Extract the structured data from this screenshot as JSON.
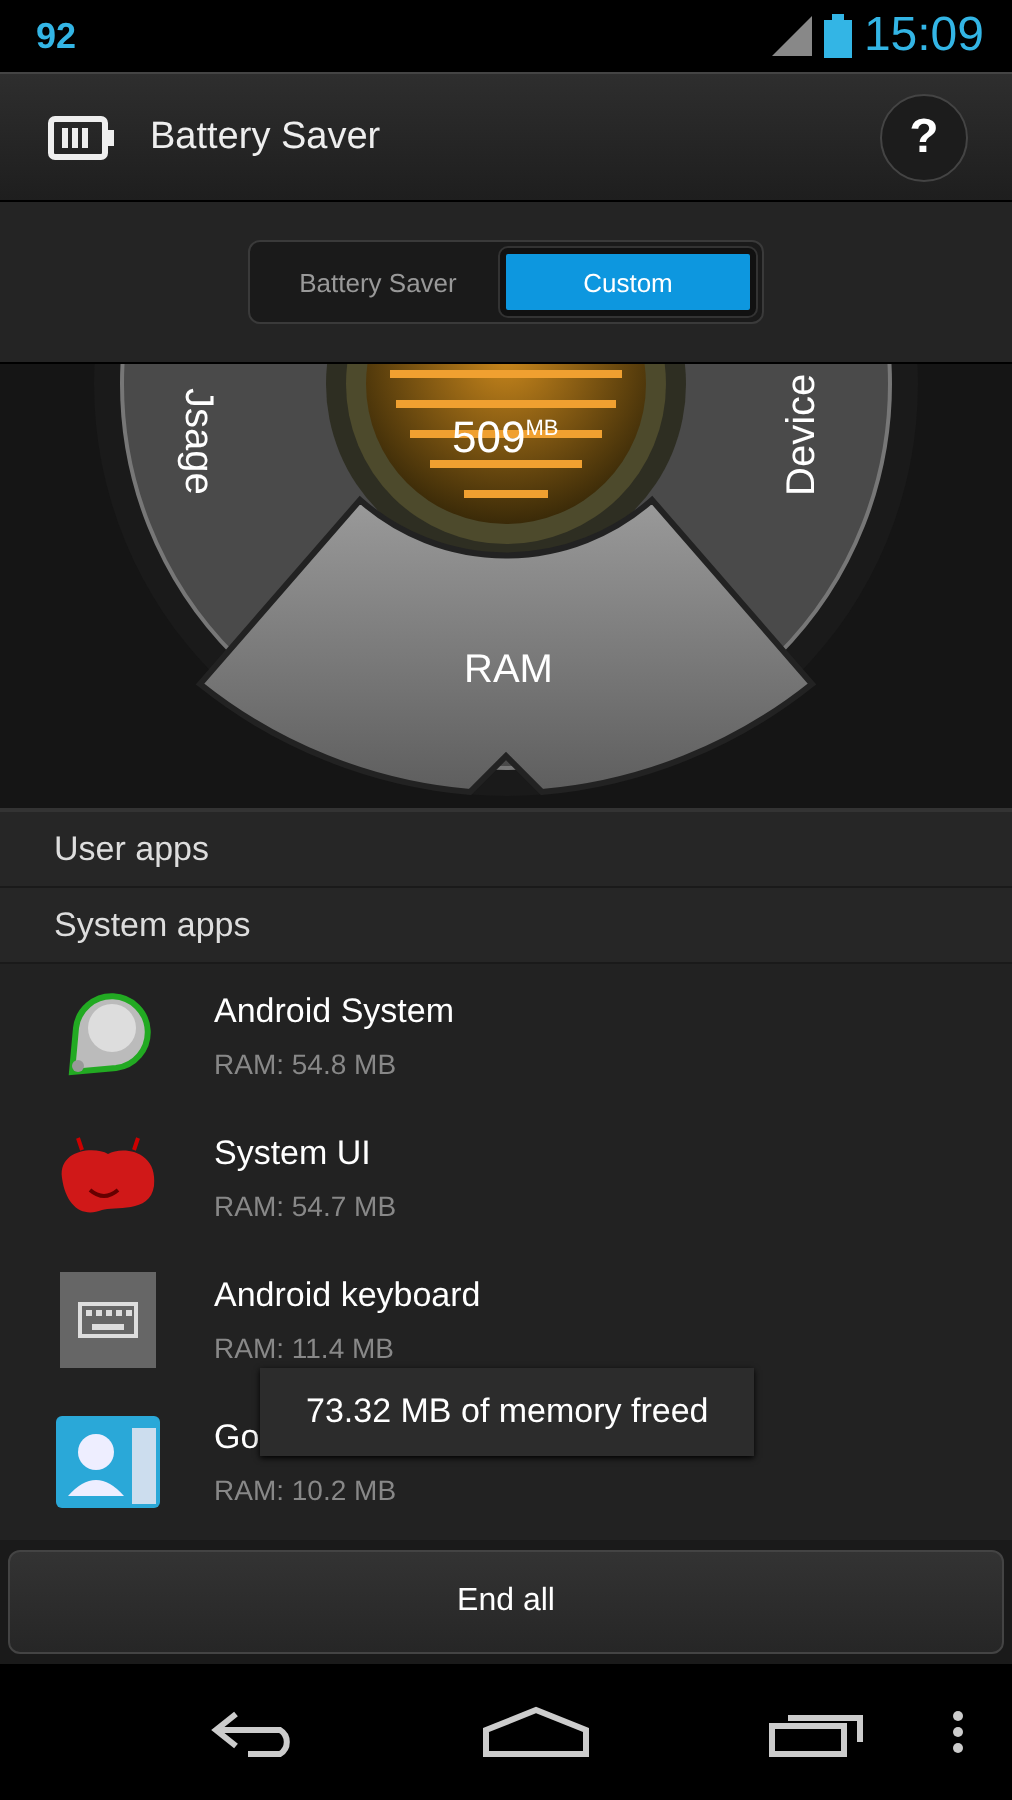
{
  "status_bar": {
    "notification": "92",
    "time": "15:09"
  },
  "action_bar": {
    "title": "Battery Saver",
    "help": "?"
  },
  "mode_switch": [
    {
      "label": "Battery Saver",
      "selected": false
    },
    {
      "label": "Custom",
      "selected": true
    }
  ],
  "dial": {
    "left_label": "Jsage",
    "right_label": "Device",
    "bottom_label": "RAM",
    "value": "509",
    "unit": "MB"
  },
  "sections": [
    {
      "label": "User apps"
    },
    {
      "label": "System apps"
    }
  ],
  "apps": [
    {
      "kind": "system",
      "name": "Android System",
      "ram": "RAM: 54.8 MB"
    },
    {
      "kind": "jellybean",
      "name": "System UI",
      "ram": "RAM: 54.7 MB"
    },
    {
      "kind": "keyboard",
      "name": "Android keyboard",
      "ram": "RAM: 11.4 MB"
    },
    {
      "kind": "contacts",
      "name": "Go",
      "ram": "RAM: 10.2 MB"
    }
  ],
  "toast": "73.32 MB of memory freed",
  "end_button": "End all"
}
